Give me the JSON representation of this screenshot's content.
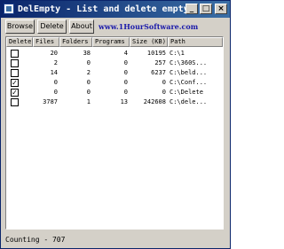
{
  "window": {
    "title": "DelEmpty - List and delete empty fold...",
    "controls": [
      "minimize-icon",
      "maximize-icon",
      "close-icon"
    ]
  },
  "toolbar": {
    "browse_label": "Browse",
    "delete_label": "Delete",
    "about_label": "About",
    "link_text": "www.1HourSoftware.com"
  },
  "table": {
    "columns": [
      "Delete",
      "Files",
      "Folders",
      "Programs",
      "Size (KB)",
      "Path"
    ],
    "rows": [
      {
        "checked": false,
        "check_mark": "",
        "files": "20",
        "folders": "38",
        "programs": "4",
        "size": "10195",
        "path": "C:\\1"
      },
      {
        "checked": false,
        "check_mark": "",
        "files": "2",
        "folders": "0",
        "programs": "0",
        "size": "257",
        "path": "C:\\360S..."
      },
      {
        "checked": false,
        "check_mark": "",
        "files": "14",
        "folders": "2",
        "programs": "0",
        "size": "6237",
        "path": "C:\\beld..."
      },
      {
        "checked": true,
        "check_mark": "✓",
        "files": "0",
        "folders": "0",
        "programs": "0",
        "size": "0",
        "path": "C:\\Conf..."
      },
      {
        "checked": true,
        "check_mark": "✓",
        "files": "0",
        "folders": "0",
        "programs": "0",
        "size": "0",
        "path": "C:\\Delete"
      },
      {
        "checked": false,
        "check_mark": "",
        "files": "3787",
        "folders": "1",
        "programs": "13",
        "size": "242608",
        "path": "C:\\dele..."
      }
    ]
  },
  "status": {
    "text": "Counting - 707"
  },
  "colors": {
    "title_start": "#0a246a",
    "title_end": "#3a6ea5",
    "face": "#d4d0c8",
    "link": "#1a1aaa"
  }
}
